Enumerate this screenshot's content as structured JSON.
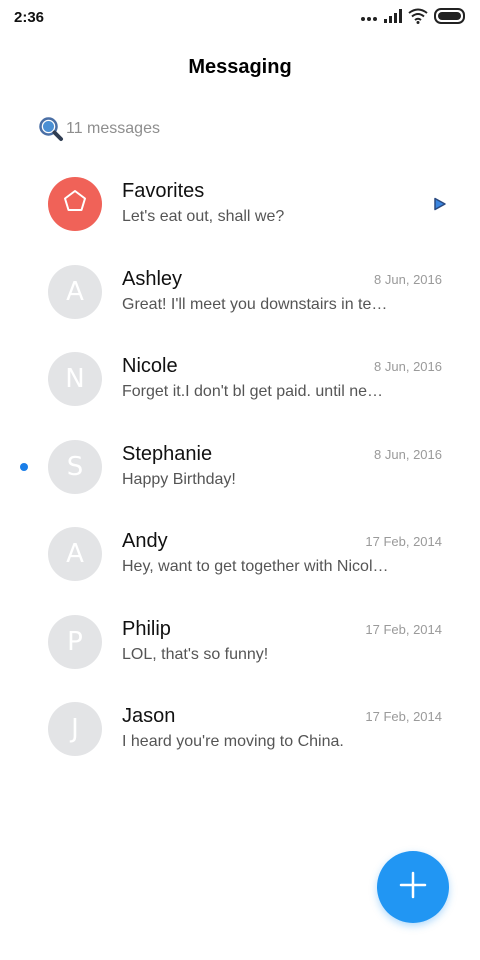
{
  "status_bar": {
    "time": "2:36"
  },
  "header": {
    "title": "Messaging"
  },
  "search": {
    "placeholder": "11 messages"
  },
  "conversations": [
    {
      "name": "Favorites",
      "preview": "Let's eat out, shall we?",
      "date": "",
      "avatar_letter": "",
      "avatar_icon": "pentagon-icon",
      "avatar_color": "#f06258",
      "unread": false,
      "trailing_icon": "play-icon"
    },
    {
      "name": "Ashley",
      "preview": "Great! I'll meet you downstairs in te…",
      "date": "8 Jun, 2016",
      "avatar_letter": "A",
      "avatar_color": "#e3e4e6",
      "unread": false
    },
    {
      "name": "Nicole",
      "preview": "Forget it.I don't bl get paid. until nex…",
      "date": "8 Jun, 2016",
      "avatar_letter": "N",
      "avatar_color": "#e3e4e6",
      "unread": false
    },
    {
      "name": "Stephanie",
      "preview": "Happy Birthday!",
      "date": "8 Jun, 2016",
      "avatar_letter": "S",
      "avatar_color": "#e3e4e6",
      "unread": true
    },
    {
      "name": "Andy",
      "preview": "Hey, want to get together with Nicol…",
      "date": "17 Feb, 2014",
      "avatar_letter": "A",
      "avatar_color": "#e3e4e6",
      "unread": false
    },
    {
      "name": "Philip",
      "preview": "LOL, that's so funny!",
      "date": "17 Feb, 2014",
      "avatar_letter": "P",
      "avatar_color": "#e3e4e6",
      "unread": false
    },
    {
      "name": "Jason",
      "preview": "I heard you're moving to China.",
      "date": "17 Feb, 2014",
      "avatar_letter": "J",
      "avatar_color": "#e3e4e6",
      "unread": false
    }
  ],
  "fab": {
    "icon": "plus-icon",
    "color": "#2196f3"
  },
  "colors": {
    "accent": "#2196f3",
    "unread_dot": "#1a7ee8",
    "favorites_avatar": "#f06258"
  }
}
